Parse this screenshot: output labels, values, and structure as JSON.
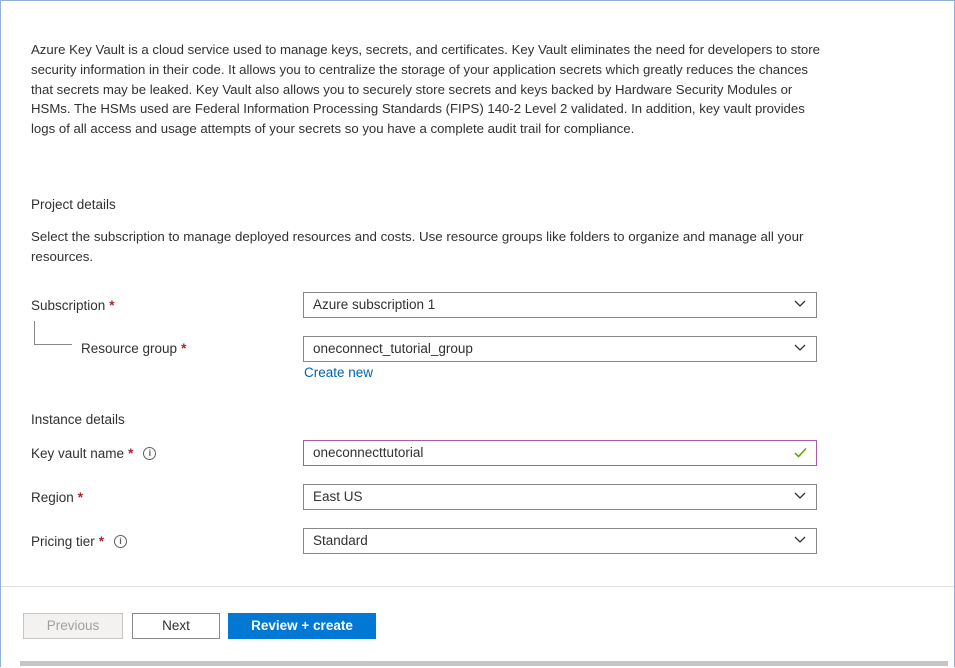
{
  "description": "Azure Key Vault is a cloud service used to manage keys, secrets, and certificates. Key Vault eliminates the need for developers to store security information in their code. It allows you to centralize the storage of your application secrets which greatly reduces the chances that secrets may be leaked. Key Vault also allows you to securely store secrets and keys backed by Hardware Security Modules or HSMs. The HSMs used are Federal Information Processing Standards (FIPS) 140-2 Level 2 validated. In addition, key vault provides logs of all access and usage attempts of your secrets so you have a complete audit trail for compliance.",
  "project": {
    "title": "Project details",
    "description": "Select the subscription to manage deployed resources and costs. Use resource groups like folders to organize and manage all your resources.",
    "subscription_label": "Subscription",
    "subscription_value": "Azure subscription 1",
    "resource_group_label": "Resource group",
    "resource_group_value": "oneconnect_tutorial_group",
    "create_new": "Create new"
  },
  "instance": {
    "title": "Instance details",
    "key_vault_name_label": "Key vault name",
    "key_vault_name_value": "oneconnecttutorial",
    "region_label": "Region",
    "region_value": "East US",
    "pricing_tier_label": "Pricing tier",
    "pricing_tier_value": "Standard"
  },
  "required_mark": "*",
  "info_glyph": "i",
  "footer": {
    "previous": "Previous",
    "next": "Next",
    "review_create": "Review + create"
  },
  "colors": {
    "accent": "#0078d4",
    "link": "#0063b1",
    "required": "#a4262c",
    "valid_check": "#57a300"
  }
}
